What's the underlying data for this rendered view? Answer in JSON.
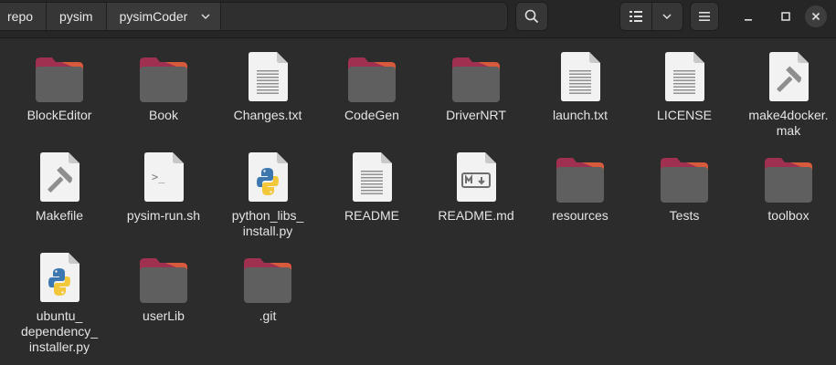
{
  "pathbar": {
    "crumbs": [
      "repo",
      "pysim",
      "pysimCoder"
    ]
  },
  "toolbar": {
    "search_icon": "search-icon",
    "view_icon": "list-view-icon",
    "view_menu_icon": "chevron-down-icon",
    "menu_icon": "hamburger-menu-icon"
  },
  "window": {
    "minimize_icon": "minimize-icon",
    "maximize_icon": "maximize-icon",
    "close_icon": "close-icon"
  },
  "colors": {
    "background": "#2c2c2c",
    "folder_body": "#5f5f5f",
    "folder_tab": "#a0304f",
    "folder_accent": "#e0623a",
    "document": "#f2f2f2"
  },
  "files": [
    {
      "name": "BlockEditor",
      "type": "folder"
    },
    {
      "name": "Book",
      "type": "folder"
    },
    {
      "name": "Changes.txt",
      "type": "text"
    },
    {
      "name": "CodeGen",
      "type": "folder"
    },
    {
      "name": "DriverNRT",
      "type": "folder"
    },
    {
      "name": "launch.txt",
      "type": "text"
    },
    {
      "name": "LICENSE",
      "type": "text"
    },
    {
      "name": "make4docker.\nmak",
      "type": "build"
    },
    {
      "name": "Makefile",
      "type": "build"
    },
    {
      "name": "pysim-run.sh",
      "type": "script"
    },
    {
      "name": "python_libs_\ninstall.py",
      "type": "python"
    },
    {
      "name": "README",
      "type": "text"
    },
    {
      "name": "README.md",
      "type": "markdown"
    },
    {
      "name": "resources",
      "type": "folder"
    },
    {
      "name": "Tests",
      "type": "folder"
    },
    {
      "name": "toolbox",
      "type": "folder"
    },
    {
      "name": "ubuntu_\ndependency_\ninstaller.py",
      "type": "python"
    },
    {
      "name": "userLib",
      "type": "folder"
    },
    {
      "name": ".git",
      "type": "folder"
    }
  ]
}
